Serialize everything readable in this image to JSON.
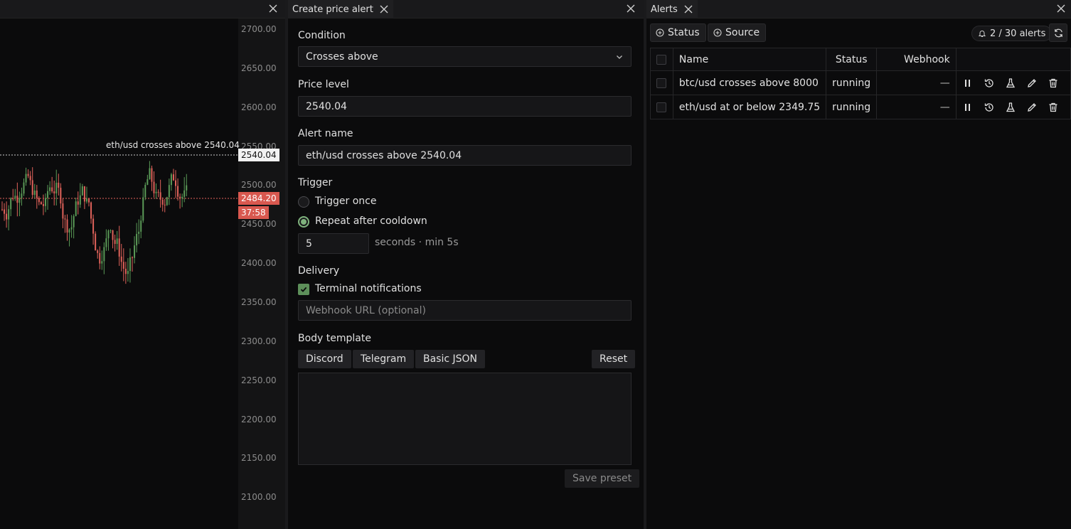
{
  "chart": {
    "y_ticks": [
      "2700.00",
      "2650.00",
      "2600.00",
      "2550.00",
      "2500.00",
      "2450.00",
      "2400.00",
      "2350.00",
      "2300.00",
      "2250.00",
      "2200.00",
      "2150.00",
      "2100.00"
    ],
    "alert_line_label": "eth/usd crosses above 2540.04",
    "alert_price_tag": "2540.04",
    "last_price_tag": "2484.20",
    "countdown_tag": "37:58",
    "colors": {
      "up": "#5b9a57",
      "down": "#e0625a",
      "tag_red": "#d9584f"
    }
  },
  "form": {
    "tab_title": "Create price alert",
    "condition_label": "Condition",
    "condition_value": "Crosses above",
    "price_label": "Price level",
    "price_value": "2540.04",
    "name_label": "Alert name",
    "name_value": "eth/usd crosses above 2540.04",
    "trigger_label": "Trigger",
    "trigger_once": "Trigger once",
    "trigger_repeat": "Repeat after cooldown",
    "cooldown_value": "5",
    "cooldown_hint": "seconds · min 5s",
    "delivery_label": "Delivery",
    "terminal_notifications": "Terminal notifications",
    "webhook_placeholder": "Webhook URL (optional)",
    "body_template_label": "Body template",
    "preset_buttons": [
      "Discord",
      "Telegram",
      "Basic JSON"
    ],
    "reset_label": "Reset",
    "save_preset_label": "Save preset"
  },
  "alerts": {
    "tab_title": "Alerts",
    "filter_status": "Status",
    "filter_source": "Source",
    "count": "2 / 30 alerts",
    "columns": {
      "name": "Name",
      "status": "Status",
      "webhook": "Webhook"
    },
    "rows": [
      {
        "name": "btc/usd crosses above 8000",
        "status": "running",
        "webhook": "—"
      },
      {
        "name": "eth/usd at or below 2349.75",
        "status": "running",
        "webhook": "—"
      }
    ]
  }
}
